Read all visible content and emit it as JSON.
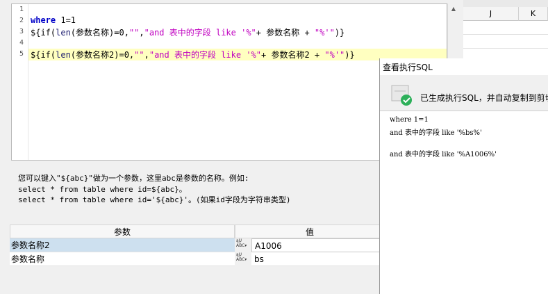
{
  "editor": {
    "lines": [
      {
        "num": "1",
        "text": ""
      },
      {
        "num": "2",
        "where_kw": "where",
        "rest": " 1=1"
      },
      {
        "num": "3",
        "p1": "${if(",
        "fn": "len",
        "p2": "(参数名称)=0,",
        "s1": "\"\"",
        "p3": ",",
        "s2": "\"and 表中的字段 like '%\"",
        "p4": "+ 参数名称 + ",
        "s3": "\"%'\"",
        "p5": ")}"
      },
      {
        "num": "4",
        "text": ""
      },
      {
        "num": "5",
        "p1": "${if(",
        "fn": "len",
        "p2": "(参数名称2)=0,",
        "s1": "\"\"",
        "p3": ",",
        "s2": "\"and 表中的字段 like '%\"",
        "p4": "+ 参数名称2 + ",
        "s3": "\"%'\"",
        "p5": ")}"
      }
    ]
  },
  "hint": {
    "line1": "您可以键入\"${abc}\"做为一个参数，这里abc是参数的名称。例如:",
    "line2": "select * from table where id=${abc}。",
    "line3": "select * from table where id='${abc}'。(如果id字段为字符串类型)"
  },
  "grid": {
    "col_param": "参数",
    "col_value": "值",
    "rows": [
      {
        "name": "参数名称2",
        "type": "ABC",
        "value": "A1006",
        "selected": true
      },
      {
        "name": "参数名称",
        "type": "ABC",
        "value": "bs",
        "selected": false
      }
    ]
  },
  "sheet": {
    "col_j": "J",
    "col_k": "K"
  },
  "dialog": {
    "title": "查看执行SQL",
    "message": "已生成执行SQL，并自动复制到剪切",
    "sql_line1": "where 1=1",
    "sql_line2": "and 表中的字段 like '%bs%'",
    "sql_line3": "",
    "sql_line4": "and 表中的字段 like '%A1006%'"
  },
  "colors": {
    "highlight": "#ffffc0",
    "selected_row": "#cde0ef",
    "keyword": "#0000c8",
    "string": "#c000c0",
    "success": "#2db05a"
  }
}
